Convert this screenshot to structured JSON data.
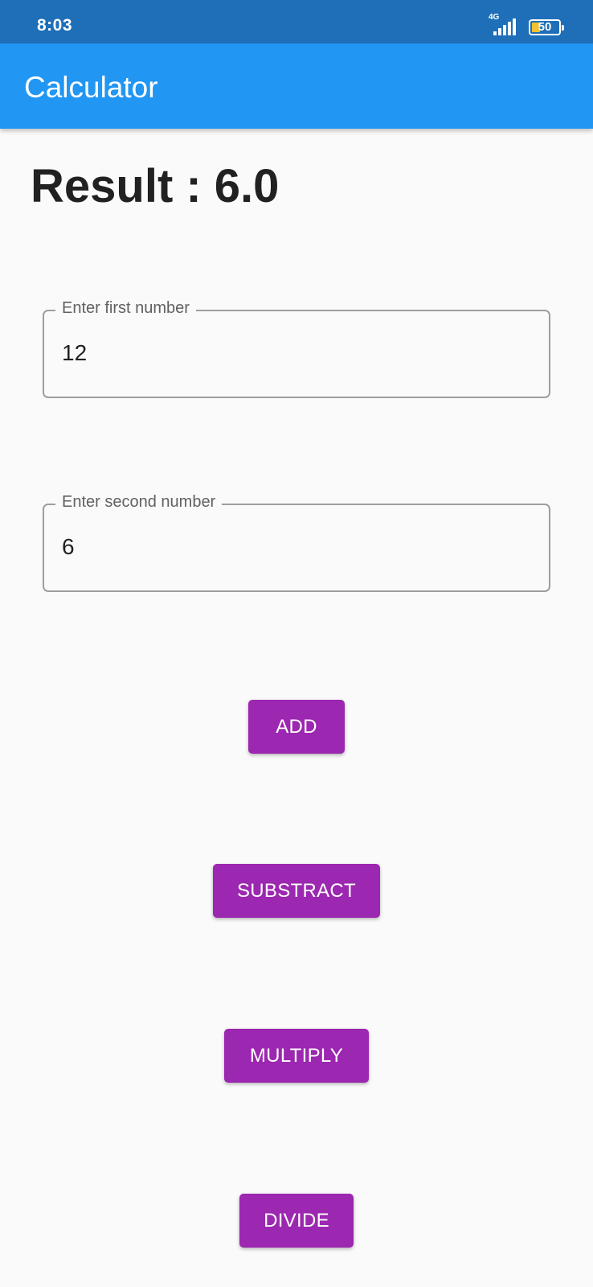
{
  "status_bar": {
    "time": "8:03",
    "network": "4G",
    "battery": "50",
    "battery_level_percent": 50
  },
  "app_bar": {
    "title": "Calculator"
  },
  "result": {
    "text": "Result : 6.0"
  },
  "fields": [
    {
      "label": "Enter first number",
      "value": "12"
    },
    {
      "label": "Enter second number",
      "value": "6"
    }
  ],
  "buttons": {
    "add": "ADD",
    "subtract": "SUBSTRACT",
    "multiply": "MULTIPLY",
    "divide": "DIVIDE"
  },
  "colors": {
    "status_bar": "#1e6fb8",
    "app_bar": "#2196f3",
    "button": "#9c27b0",
    "background": "#fafafa"
  }
}
